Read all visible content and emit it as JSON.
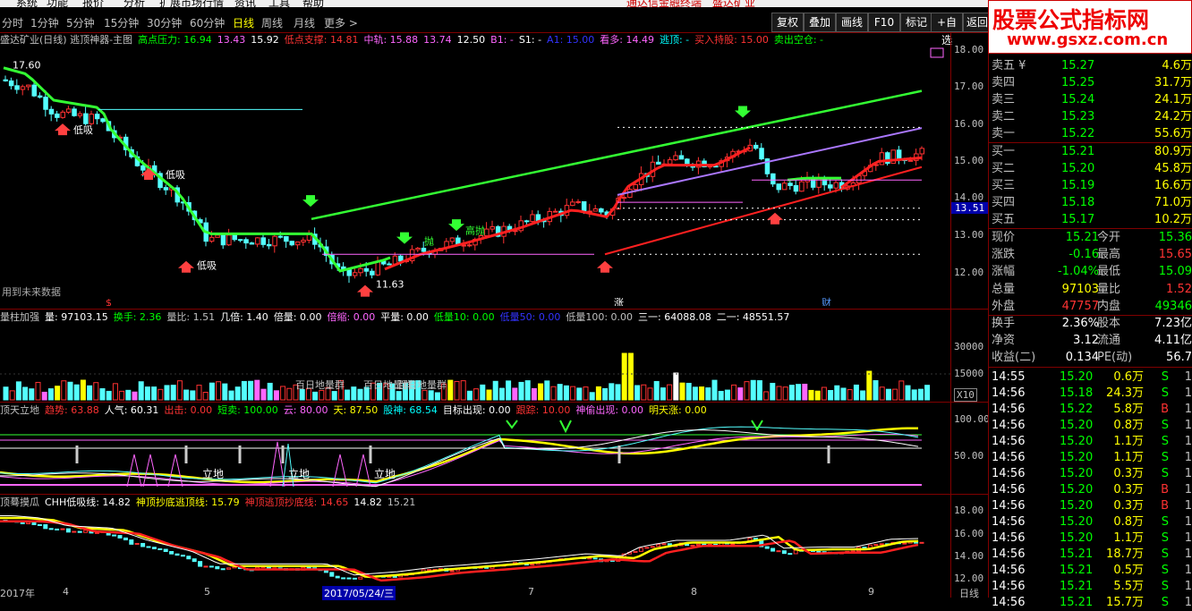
{
  "menu": {
    "items": [
      "系统",
      "功能",
      "报价",
      "分析",
      "扩展市场行情",
      "资讯",
      "工具",
      "帮助"
    ],
    "center_title": "通达信金融终端",
    "stock_title": "盛达矿业"
  },
  "tabs": [
    "分时",
    "1分钟",
    "5分钟",
    "15分钟",
    "30分钟",
    "60分钟",
    "日线",
    "周线",
    "月线",
    "更多 >"
  ],
  "active_tab": "日线",
  "toolbar": {
    "buttons": [
      "复权",
      "叠加",
      "画线",
      "F10",
      "标记",
      "+自选",
      "返回"
    ]
  },
  "main": {
    "title": "盛达矿业(日线) 逃顶神器-主图",
    "items": [
      {
        "label": "高点压力:",
        "value": "16.94",
        "color": "#00ff00"
      },
      {
        "label": "",
        "value": "13.43",
        "color": "#ff66ff"
      },
      {
        "label": "",
        "value": "15.92",
        "color": "#ffffff"
      },
      {
        "label": "低点支撑:",
        "value": "14.81",
        "color": "#ff3333"
      },
      {
        "label": "中轨:",
        "value": "15.88",
        "color": "#ff66ff"
      },
      {
        "label": "",
        "value": "13.74",
        "color": "#ff66ff"
      },
      {
        "label": "",
        "value": "12.50",
        "color": "#ffffff"
      },
      {
        "label": "B1:",
        "value": "-",
        "color": "#ff66ff"
      },
      {
        "label": "S1:",
        "value": "-",
        "color": "#ffffff"
      },
      {
        "label": "A1:",
        "value": "15.00",
        "color": "#3333ff"
      },
      {
        "label": "看多:",
        "value": "14.49",
        "color": "#ff66ff"
      },
      {
        "label": "逃顶:",
        "value": "-",
        "color": "#00ffff"
      },
      {
        "label": "买入持股:",
        "value": "15.00",
        "color": "#ff3333"
      },
      {
        "label": "卖出空仓:",
        "value": "-",
        "color": "#00ff00"
      }
    ],
    "y_ticks": [
      "18.00",
      "17.00",
      "16.00",
      "15.00",
      "14.00",
      "13.00",
      "12.00"
    ],
    "current_price_tag": "13.51",
    "high_label": "17.60",
    "low_label": "11.63",
    "signal_labels": [
      "低吸",
      "低吸",
      "低吸",
      "抛",
      "高抛"
    ],
    "future_note": "用到未来数据",
    "markers": [
      "$",
      "涨",
      "财"
    ]
  },
  "volume": {
    "title": "量柱加强",
    "items": [
      {
        "label": "量:",
        "value": "97103.15",
        "color": "#ffffff"
      },
      {
        "label": "换手:",
        "value": "2.36",
        "color": "#00ff00"
      },
      {
        "label": "量比:",
        "value": "1.51",
        "color": "#c0c0c0"
      },
      {
        "label": "几倍:",
        "value": "1.40",
        "color": "#ffffff"
      },
      {
        "label": "倍量:",
        "value": "0.00",
        "color": "#ffffff"
      },
      {
        "label": "倍缩:",
        "value": "0.00",
        "color": "#ff66ff"
      },
      {
        "label": "平量:",
        "value": "0.00",
        "color": "#ffffff"
      },
      {
        "label": "低量10:",
        "value": "0.00",
        "color": "#00ff00"
      },
      {
        "label": "低量50:",
        "value": "0.00",
        "color": "#3333ff"
      },
      {
        "label": "低量100:",
        "value": "0.00",
        "color": "#c0c0c0"
      },
      {
        "label": "三一:",
        "value": "64088.08",
        "color": "#ffffff"
      },
      {
        "label": "二一:",
        "value": "48551.57",
        "color": "#ffffff"
      }
    ],
    "y_ticks": [
      "30000",
      "15000"
    ],
    "unit": "X10",
    "annotations": [
      "百日地量群",
      "百日地量群",
      "百日地量群"
    ]
  },
  "ind1": {
    "title": "顶天立地",
    "items": [
      {
        "label": "趋势:",
        "value": "63.88",
        "color": "#ff3333"
      },
      {
        "label": "人气:",
        "value": "60.31",
        "color": "#ffffff"
      },
      {
        "label": "出击:",
        "value": "0.00",
        "color": "#ff3333"
      },
      {
        "label": "短卖:",
        "value": "100.00",
        "color": "#00ff00"
      },
      {
        "label": "云:",
        "value": "80.00",
        "color": "#ff66ff"
      },
      {
        "label": "天:",
        "value": "87.50",
        "color": "#ffff00"
      },
      {
        "label": "股神:",
        "value": "68.54",
        "color": "#00ffff"
      },
      {
        "label": "目标出现:",
        "value": "0.00",
        "color": "#ffffff"
      },
      {
        "label": "跟踪:",
        "value": "10.00",
        "color": "#ff3333"
      },
      {
        "label": "神偷出现:",
        "value": "0.00",
        "color": "#ff66ff"
      },
      {
        "label": "明天涨:",
        "value": "0.00",
        "color": "#ffff00"
      }
    ],
    "y_ticks": [
      "100.00",
      "50.00"
    ],
    "labels": [
      "立地",
      "立地",
      "立地"
    ]
  },
  "ind2": {
    "title": "顶蓦摸瓜",
    "items": [
      {
        "label": "CHH低吸线:",
        "value": "14.82",
        "color": "#ffffff"
      },
      {
        "label": "神顶抄底逃顶线:",
        "value": "15.79",
        "color": "#ffff00"
      },
      {
        "label": "神顶逃顶抄底线:",
        "value": "14.65",
        "color": "#ff3333"
      },
      {
        "label": "",
        "value": "14.82",
        "color": "#ffffff"
      },
      {
        "label": "",
        "value": "15.21",
        "color": "#c0c0c0"
      }
    ],
    "y_ticks": [
      "18.00",
      "16.00",
      "14.00",
      "12.00"
    ]
  },
  "x_axis": {
    "labels": [
      "2017年",
      "4",
      "5",
      "2017/05/24/三",
      "7",
      "8",
      "9"
    ],
    "period": "日线"
  },
  "watermark": {
    "title": "股票公式指标网",
    "url": "www.gsxz.com.cn"
  },
  "order_book": {
    "sell": [
      {
        "label": "卖五",
        "price": "15.27",
        "vol": "4.6万"
      },
      {
        "label": "卖四",
        "price": "15.25",
        "vol": "31.7万"
      },
      {
        "label": "卖三",
        "price": "15.24",
        "vol": "24.1万"
      },
      {
        "label": "卖二",
        "price": "15.23",
        "vol": "24.2万"
      },
      {
        "label": "卖一",
        "price": "15.22",
        "vol": "55.6万"
      }
    ],
    "buy": [
      {
        "label": "买一",
        "price": "15.21",
        "vol": "80.9万"
      },
      {
        "label": "买二",
        "price": "15.20",
        "vol": "45.8万"
      },
      {
        "label": "买三",
        "price": "15.19",
        "vol": "16.6万"
      },
      {
        "label": "买四",
        "price": "15.18",
        "vol": "71.0万"
      },
      {
        "label": "买五",
        "price": "15.17",
        "vol": "10.2万"
      }
    ]
  },
  "quote": [
    {
      "l1": "现价",
      "v1": "15.21",
      "c1": "#00ff00",
      "l2": "今开",
      "v2": "15.36",
      "c2": "#00ff00"
    },
    {
      "l1": "涨跌",
      "v1": "-0.16",
      "c1": "#00ff00",
      "l2": "最高",
      "v2": "15.65",
      "c2": "#ff3333"
    },
    {
      "l1": "涨幅",
      "v1": "-1.04%",
      "c1": "#00ff00",
      "l2": "最低",
      "v2": "15.09",
      "c2": "#00ff00"
    },
    {
      "l1": "总量",
      "v1": "97103",
      "c1": "#ffff00",
      "l2": "量比",
      "v2": "1.52",
      "c2": "#ff3333"
    },
    {
      "l1": "外盘",
      "v1": "47757",
      "c1": "#ff3333",
      "l2": "内盘",
      "v2": "49346",
      "c2": "#00ff00"
    },
    {
      "l1": "换手",
      "v1": "2.36%",
      "c1": "#ffffff",
      "l2": "股本",
      "v2": "7.23亿",
      "c2": "#ffffff"
    },
    {
      "l1": "净资",
      "v1": "3.12",
      "c1": "#ffffff",
      "l2": "流通",
      "v2": "4.11亿",
      "c2": "#ffffff"
    },
    {
      "l1": "收益(二)",
      "v1": "0.134",
      "c1": "#ffffff",
      "l2": "PE(动)",
      "v2": "56.7",
      "c2": "#ffffff"
    }
  ],
  "ticks": [
    {
      "time": "14:55",
      "price": "15.20",
      "vol": "0.6万",
      "bs": "S"
    },
    {
      "time": "14:56",
      "price": "15.18",
      "vol": "24.3万",
      "bs": "S"
    },
    {
      "time": "14:56",
      "price": "15.22",
      "vol": "5.8万",
      "bs": "B"
    },
    {
      "time": "14:56",
      "price": "15.20",
      "vol": "0.8万",
      "bs": "S"
    },
    {
      "time": "14:56",
      "price": "15.20",
      "vol": "1.1万",
      "bs": "S"
    },
    {
      "time": "14:56",
      "price": "15.20",
      "vol": "1.1万",
      "bs": "S"
    },
    {
      "time": "14:56",
      "price": "15.20",
      "vol": "0.3万",
      "bs": "S"
    },
    {
      "time": "14:56",
      "price": "15.20",
      "vol": "0.3万",
      "bs": "B"
    },
    {
      "time": "14:56",
      "price": "15.20",
      "vol": "0.3万",
      "bs": "B"
    },
    {
      "time": "14:56",
      "price": "15.20",
      "vol": "0.8万",
      "bs": "S"
    },
    {
      "time": "14:56",
      "price": "15.20",
      "vol": "1.1万",
      "bs": "S"
    },
    {
      "time": "14:56",
      "price": "15.21",
      "vol": "18.7万",
      "bs": "S"
    },
    {
      "time": "14:56",
      "price": "15.21",
      "vol": "0.5万",
      "bs": "S"
    },
    {
      "time": "14:56",
      "price": "15.21",
      "vol": "5.5万",
      "bs": "S"
    },
    {
      "time": "14:56",
      "price": "15.21",
      "vol": "15.7万",
      "bs": "S"
    }
  ]
}
